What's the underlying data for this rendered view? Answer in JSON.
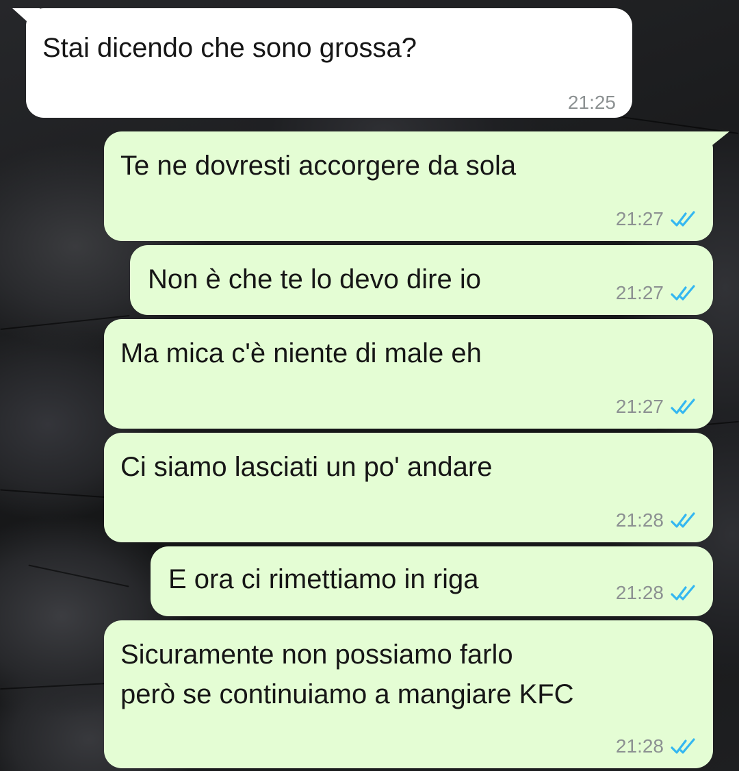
{
  "chat": {
    "messages": [
      {
        "direction": "incoming",
        "text_lines": [
          "Stai dicendo che sono grossa?"
        ],
        "time": "21:25"
      },
      {
        "direction": "outgoing",
        "text_lines": [
          "Te ne dovresti accorgere da sola"
        ],
        "time": "21:27",
        "status_icon": "double-check-read-icon"
      },
      {
        "direction": "outgoing",
        "text_lines": [
          "Non è che te lo devo dire io"
        ],
        "time": "21:27",
        "status_icon": "double-check-read-icon"
      },
      {
        "direction": "outgoing",
        "text_lines": [
          "Ma mica c'è niente di male eh"
        ],
        "time": "21:27",
        "status_icon": "double-check-read-icon"
      },
      {
        "direction": "outgoing",
        "text_lines": [
          "Ci siamo lasciati un po' andare"
        ],
        "time": "21:28",
        "status_icon": "double-check-read-icon"
      },
      {
        "direction": "outgoing",
        "text_lines": [
          "E ora ci rimettiamo in riga"
        ],
        "time": "21:28",
        "status_icon": "double-check-read-icon"
      },
      {
        "direction": "outgoing",
        "text_lines": [
          "Sicuramente non possiamo farlo",
          "però se continuiamo a mangiare KFC"
        ],
        "time": "21:28",
        "status_icon": "double-check-read-icon"
      }
    ]
  },
  "colors": {
    "incoming_bubble": "#ffffff",
    "outgoing_bubble": "#e4fdd4",
    "read_ticks": "#34b7f1",
    "timestamp": "#8c9192",
    "wallpaper": "#1c1d1f"
  }
}
